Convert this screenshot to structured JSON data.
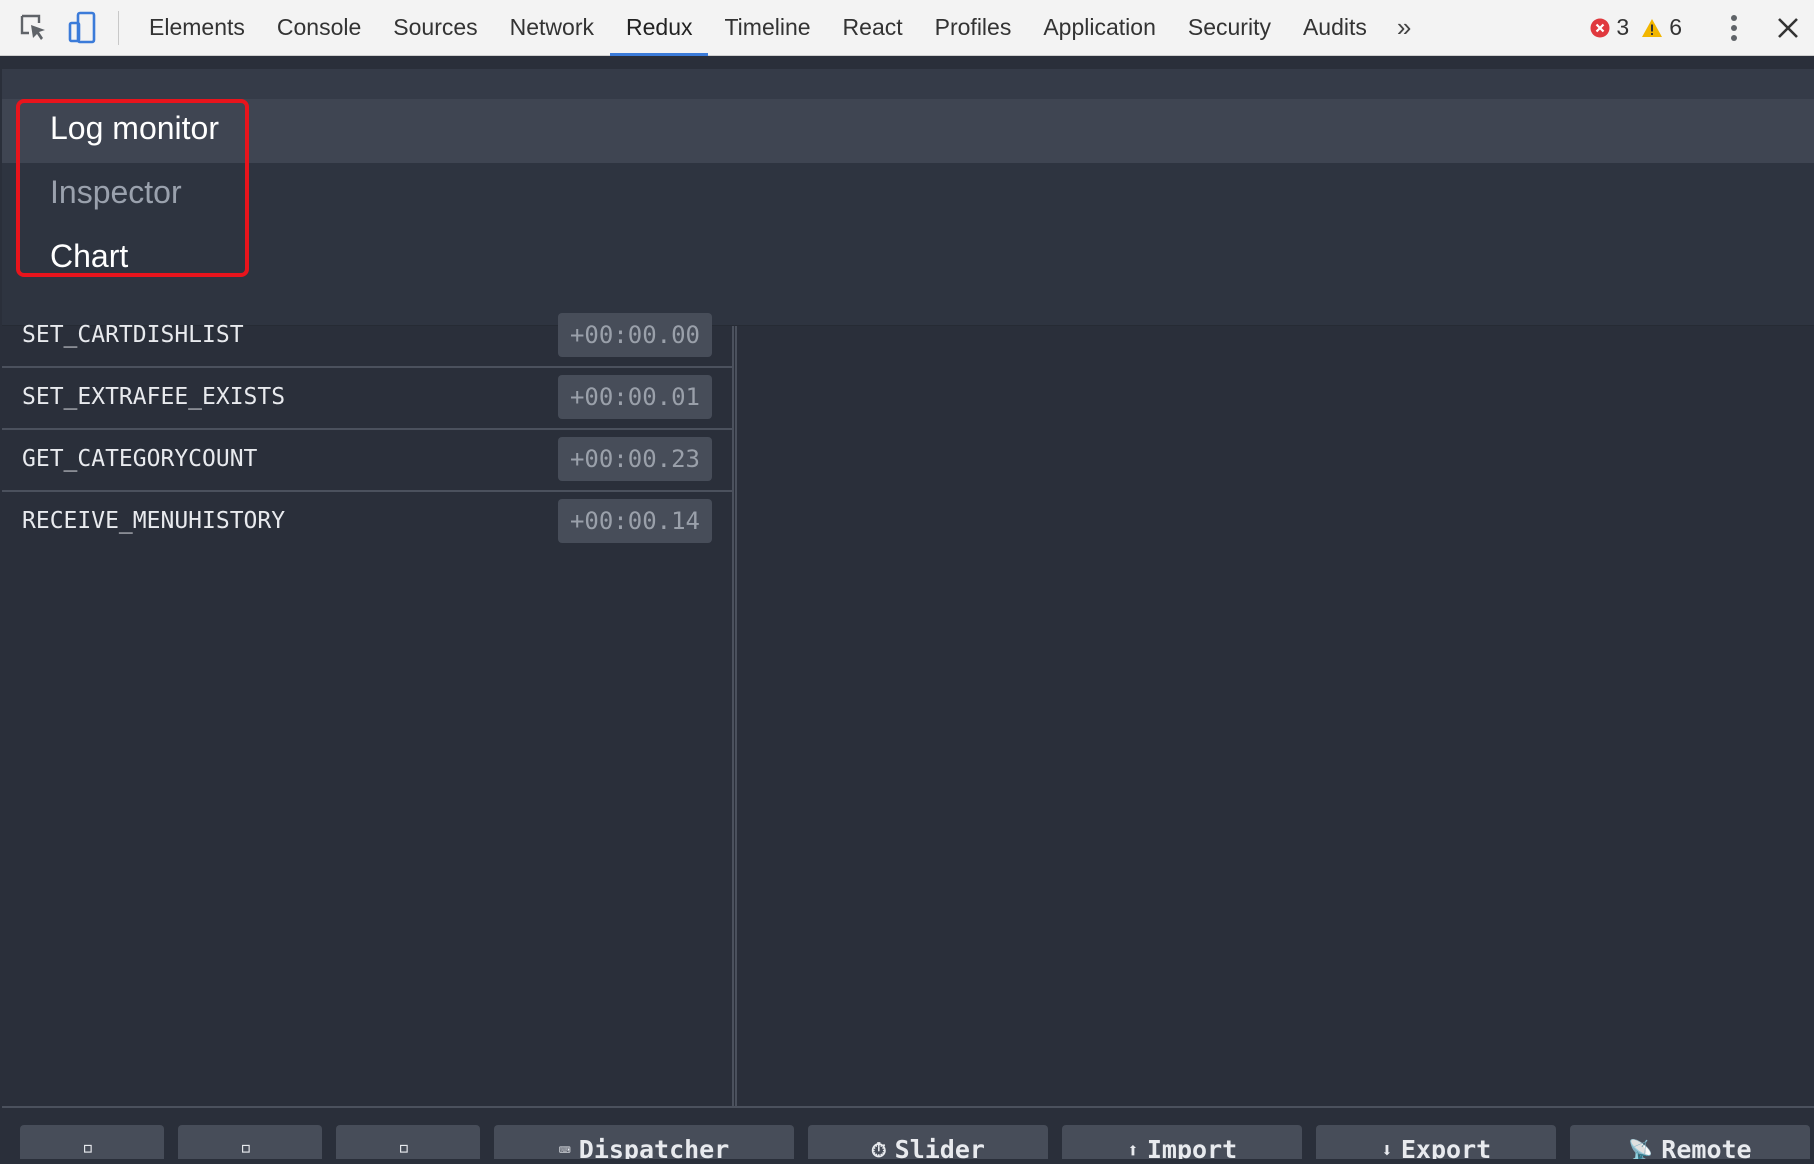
{
  "toolbar": {
    "tabs": [
      {
        "label": "Elements"
      },
      {
        "label": "Console"
      },
      {
        "label": "Sources"
      },
      {
        "label": "Network"
      },
      {
        "label": "Redux",
        "active": true
      },
      {
        "label": "Timeline"
      },
      {
        "label": "React"
      },
      {
        "label": "Profiles"
      },
      {
        "label": "Application"
      },
      {
        "label": "Security"
      },
      {
        "label": "Audits"
      }
    ],
    "more_label": "»",
    "error_count": "3",
    "warning_count": "6"
  },
  "monitor_menu": {
    "items": [
      "Log monitor",
      "Inspector",
      "Chart"
    ]
  },
  "actions": [
    {
      "name": "SET_CARTDISHLIST",
      "time": "+00:00.00"
    },
    {
      "name": "SET_EXTRAFEE_EXISTS",
      "time": "+00:00.01"
    },
    {
      "name": "GET_CATEGORYCOUNT",
      "time": "+00:00.23"
    },
    {
      "name": "RECEIVE_MENUHISTORY",
      "time": "+00:00.14"
    }
  ],
  "bottom_buttons": [
    {
      "label": "",
      "icon": "▫"
    },
    {
      "label": "",
      "icon": "▫"
    },
    {
      "label": "",
      "icon": "▫"
    },
    {
      "label": "Dispatcher",
      "icon": "⌨"
    },
    {
      "label": "Slider",
      "icon": "⏱"
    },
    {
      "label": "Import",
      "icon": "⬆"
    },
    {
      "label": "Export",
      "icon": "⬇"
    },
    {
      "label": "Remote",
      "icon": "📡"
    }
  ],
  "colors": {
    "panel_bg": "#2a2f3a",
    "active_tab_underline": "#3b7bd9",
    "highlight_box": "#e8141c",
    "error_red": "#e0393e",
    "warning_yellow": "#f2b600"
  }
}
